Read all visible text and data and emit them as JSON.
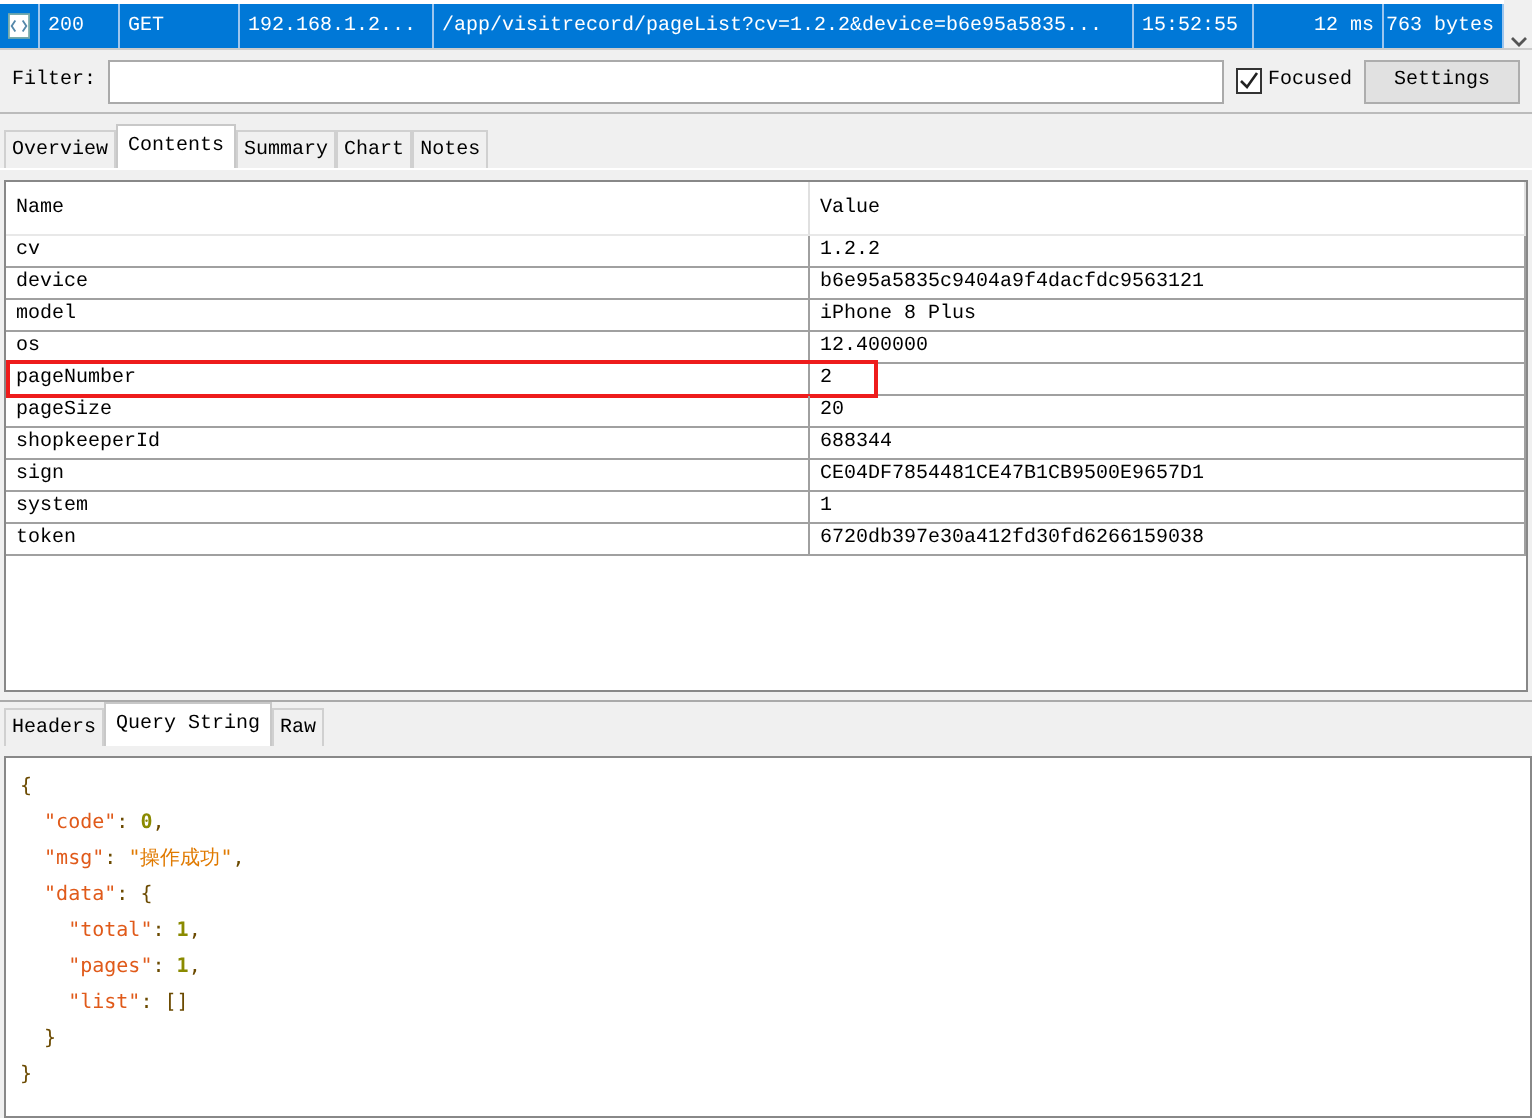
{
  "request": {
    "selected": true,
    "status": "200",
    "method": "GET",
    "host": "192.168.1.2...",
    "url": "/app/visitrecord/pageList?cv=1.2.2&device=b6e95a5835...",
    "time": "15:52:55",
    "duration": "12 ms",
    "size": "763 bytes"
  },
  "filter": {
    "label": "Filter:",
    "focused_label": "Focused",
    "focused_checked": true,
    "settings": "Settings"
  },
  "tabs": [
    {
      "label": "Overview",
      "selected": false
    },
    {
      "label": "Contents",
      "selected": true
    },
    {
      "label": "Summary",
      "selected": false
    },
    {
      "label": "Chart",
      "selected": false
    },
    {
      "label": "Notes",
      "selected": false
    }
  ],
  "table": {
    "columns": [
      "Name",
      "Value"
    ],
    "rows": [
      {
        "name": "cv",
        "value": "1.2.2",
        "highlighted": false
      },
      {
        "name": "device",
        "value": "b6e95a5835c9404a9f4dacfdc9563121",
        "highlighted": false
      },
      {
        "name": "model",
        "value": "iPhone 8 Plus",
        "highlighted": false
      },
      {
        "name": "os",
        "value": "12.400000",
        "highlighted": false
      },
      {
        "name": "pageNumber",
        "value": "2",
        "highlighted": true
      },
      {
        "name": "pageSize",
        "value": "20",
        "highlighted": false
      },
      {
        "name": "shopkeeperId",
        "value": "688344",
        "highlighted": false
      },
      {
        "name": "sign",
        "value": "CE04DF7854481CE47B1CB9500E9657D1",
        "highlighted": false
      },
      {
        "name": "system",
        "value": "1",
        "highlighted": false
      },
      {
        "name": "token",
        "value": "6720db397e30a412fd30fd6266159038",
        "highlighted": false
      }
    ]
  },
  "bottom_tabs": [
    {
      "label": "Headers",
      "selected": false
    },
    {
      "label": "Query String",
      "selected": true
    },
    {
      "label": "Raw",
      "selected": false
    }
  ],
  "code_lines": [
    [
      {
        "kind": "punct",
        "text": "{"
      }
    ],
    [
      {
        "kind": "key",
        "text": "  \"code\""
      },
      {
        "kind": "punct",
        "text": ": "
      },
      {
        "kind": "number",
        "text": "0"
      },
      {
        "kind": "punct",
        "text": ","
      }
    ],
    [
      {
        "kind": "key",
        "text": "  \"msg\""
      },
      {
        "kind": "punct",
        "text": ": "
      },
      {
        "kind": "string",
        "text": "\"操作成功\""
      },
      {
        "kind": "punct",
        "text": ","
      }
    ],
    [
      {
        "kind": "key",
        "text": "  \"data\""
      },
      {
        "kind": "punct",
        "text": ": {"
      }
    ],
    [
      {
        "kind": "key",
        "text": "    \"total\""
      },
      {
        "kind": "punct",
        "text": ": "
      },
      {
        "kind": "number",
        "text": "1"
      },
      {
        "kind": "punct",
        "text": ","
      }
    ],
    [
      {
        "kind": "key",
        "text": "    \"pages\""
      },
      {
        "kind": "punct",
        "text": ": "
      },
      {
        "kind": "number",
        "text": "1"
      },
      {
        "kind": "punct",
        "text": ","
      }
    ],
    [
      {
        "kind": "key",
        "text": "    \"list\""
      },
      {
        "kind": "punct",
        "text": ": []"
      }
    ],
    [
      {
        "kind": "punct",
        "text": "  }"
      }
    ],
    [
      {
        "kind": "punct",
        "text": "}"
      }
    ]
  ]
}
